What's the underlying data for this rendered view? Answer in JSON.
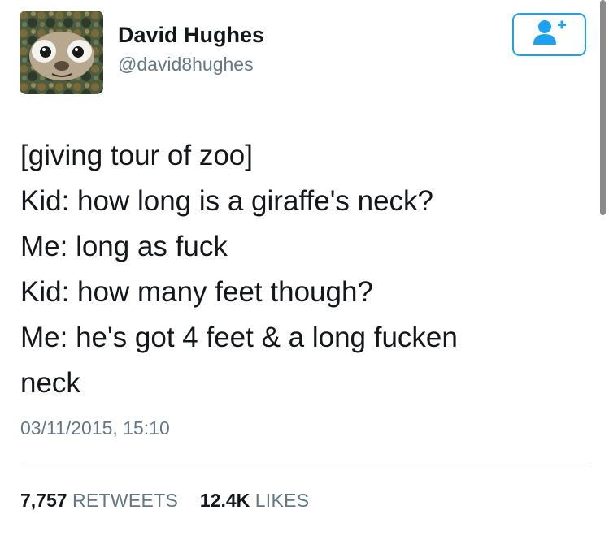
{
  "user": {
    "name": "David Hughes",
    "handle": "@david8hughes"
  },
  "follow_button": {
    "icon": "add-user-icon",
    "color": "#1da1f2"
  },
  "tweet": {
    "lines": [
      "[giving tour of zoo]",
      "Kid: how long is a giraffe's neck?",
      "Me: long as fuck",
      "Kid: how many feet though?",
      "Me: he's got 4 feet & a long fucken",
      "neck"
    ],
    "timestamp": "03/11/2015, 15:10"
  },
  "stats": {
    "retweets_count": "7,757",
    "retweets_label": "RETWEETS",
    "likes_count": "12.4K",
    "likes_label": "LIKES"
  }
}
